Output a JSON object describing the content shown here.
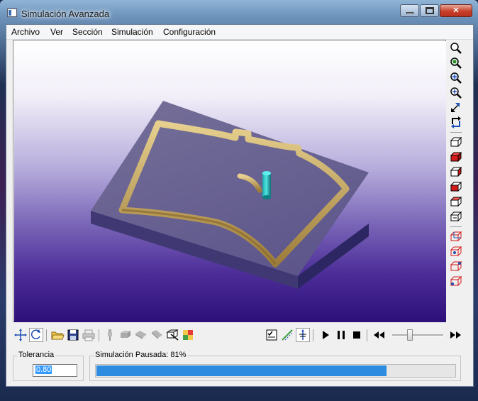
{
  "window": {
    "title": "Simulación Avanzada"
  },
  "menu": [
    "Archivo",
    "Ver",
    "Sección",
    "Simulación",
    "Configuración"
  ],
  "right_toolbar": {
    "tools": [
      "zoom-icon",
      "zoom-fit-icon",
      "zoom-window-icon",
      "zoom-in-icon",
      "fit-view-icon",
      "rotate-view-icon",
      "view-front-icon",
      "view-top-icon",
      "view-right-icon",
      "view-left-icon",
      "view-bottom-icon",
      "view-back-icon",
      "view-iso1-icon",
      "view-iso2-icon",
      "view-iso3-icon",
      "view-iso4-icon"
    ]
  },
  "bottom_toolbar": {
    "tools": [
      "pan-icon",
      "rotate-icon",
      "open-icon",
      "save-icon",
      "print-icon",
      "tool-icon",
      "solid-1-icon",
      "solid-2-icon",
      "solid-3-icon",
      "section-icon",
      "color-icon",
      "report-icon",
      "path-icon",
      "stock-icon",
      "play-icon",
      "pause-icon",
      "stop-icon",
      "rewind-icon",
      "speed-slider",
      "fast-forward-icon"
    ]
  },
  "tolerance": {
    "label": "Tolerancia",
    "value": "0.80"
  },
  "simulation": {
    "status": "Simulación Pausada: 81%",
    "progress": 0.81
  },
  "colors": {
    "progress": "#2d8be0",
    "viewport_bottom": "#2d0f7a",
    "part": "#c9a75a",
    "tool": "#1fb6b8"
  }
}
